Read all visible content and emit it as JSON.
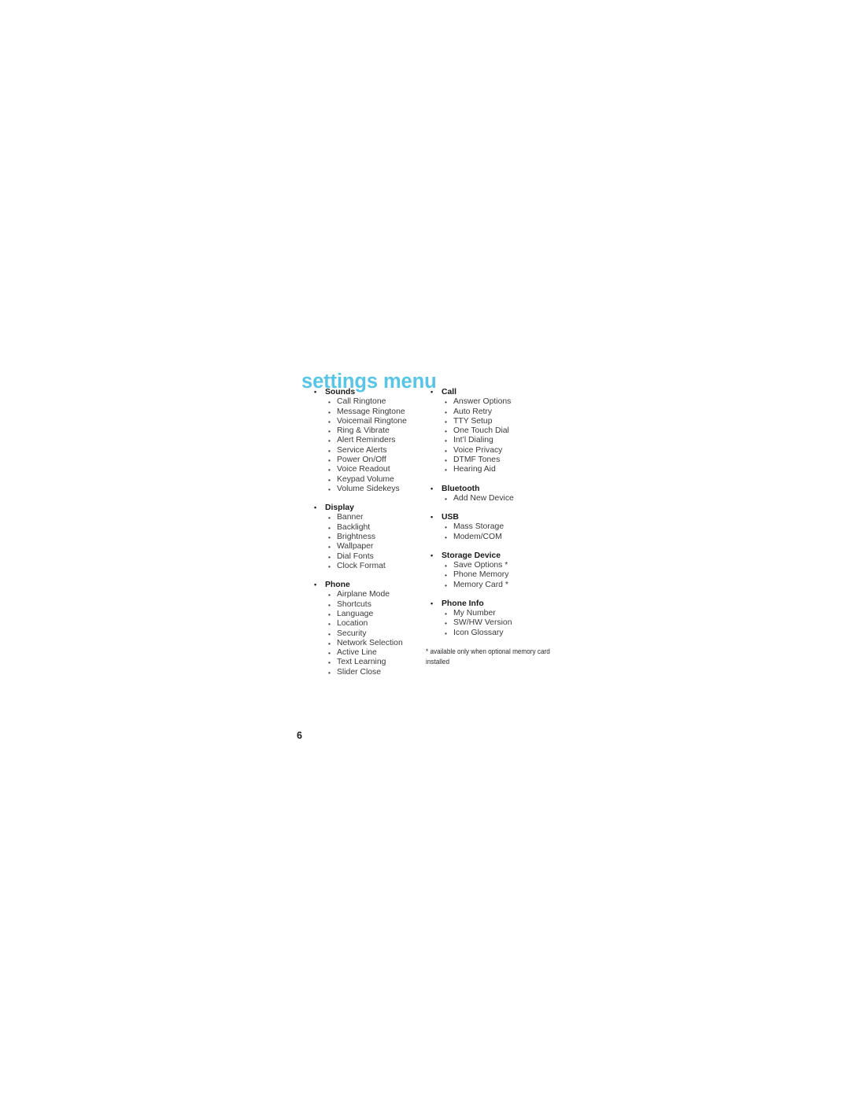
{
  "document": {
    "title": "settings menu",
    "title_color": "#56c5e8",
    "page_number": "6",
    "bullet_glyph": "•",
    "footnote": "* available only when optional memory card installed"
  },
  "columns": {
    "left": [
      {
        "label": "Sounds",
        "items": [
          "Call Ringtone",
          "Message Ringtone",
          "Voicemail Ringtone",
          "Ring & Vibrate",
          "Alert Reminders",
          "Service Alerts",
          "Power On/Off",
          "Voice Readout",
          "Keypad Volume",
          "Volume Sidekeys"
        ]
      },
      {
        "label": "Display",
        "items": [
          "Banner",
          "Backlight",
          "Brightness",
          "Wallpaper",
          "Dial Fonts",
          "Clock Format"
        ]
      },
      {
        "label": "Phone",
        "items": [
          "Airplane Mode",
          "Shortcuts",
          "Language",
          "Location",
          "Security",
          "Network Selection",
          "Active Line",
          "Text Learning",
          "Slider Close"
        ]
      }
    ],
    "right": [
      {
        "label": "Call",
        "items": [
          "Answer Options",
          "Auto Retry",
          "TTY Setup",
          "One Touch Dial",
          "Int’l Dialing",
          "Voice Privacy",
          "DTMF Tones",
          "Hearing Aid"
        ]
      },
      {
        "label": "Bluetooth",
        "items": [
          "Add New Device"
        ]
      },
      {
        "label": "USB",
        "items": [
          "Mass Storage",
          "Modem/COM"
        ]
      },
      {
        "label": "Storage Device",
        "items": [
          "Save Options *",
          "Phone Memory",
          "Memory Card *"
        ]
      },
      {
        "label": "Phone Info",
        "items": [
          "My Number",
          "SW/HW Version",
          "Icon Glossary"
        ]
      }
    ]
  }
}
